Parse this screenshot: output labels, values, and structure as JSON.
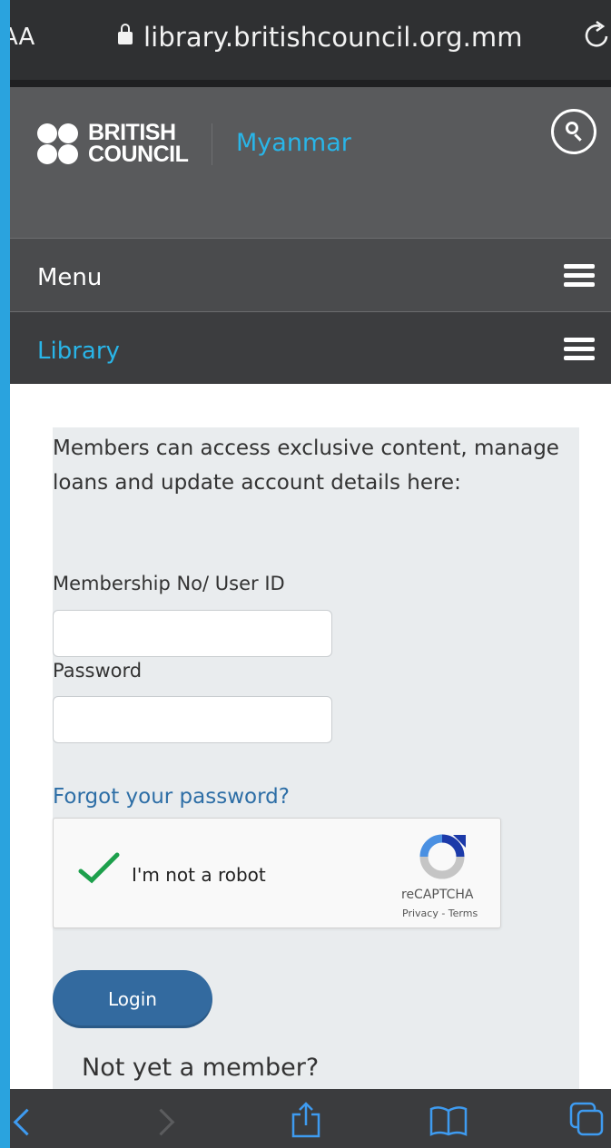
{
  "browser": {
    "aa_label": "AA",
    "url": "library.britishcouncil.org.mm"
  },
  "header": {
    "logo_line1": "BRITISH",
    "logo_line2": "COUNCIL",
    "region": "Myanmar"
  },
  "nav": {
    "menu_label": "Menu",
    "section_label": "Library"
  },
  "login": {
    "intro": "Members can access exclusive content, manage loans and update account details here:",
    "user_label": "Membership No/ User ID",
    "user_value": "",
    "password_label": "Password",
    "password_value": "",
    "forgot_link": "Forgot your password?",
    "captcha_label": "I'm not a robot",
    "captcha_brand": "reCAPTCHA",
    "captcha_terms": "Privacy - Terms",
    "login_button": "Login",
    "not_member": "Not yet a member?"
  },
  "icons": {
    "lock": "lock-icon",
    "reload": "reload-icon",
    "search": "search-icon",
    "menu": "hamburger-icon",
    "back": "chevron-left-icon",
    "forward": "chevron-right-icon",
    "share": "share-icon",
    "bookmarks": "book-icon",
    "tabs": "tabs-icon"
  },
  "colors": {
    "accent": "#29b5e8",
    "header_bg": "#595a5c",
    "link": "#2d6ea6",
    "button": "#336a9f",
    "check": "#1da04c",
    "frame": "#2aa3de"
  }
}
